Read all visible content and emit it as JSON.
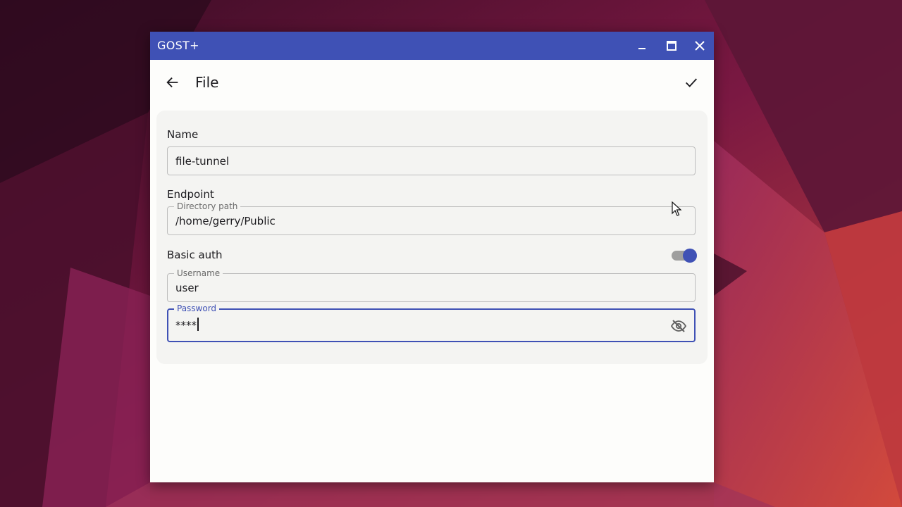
{
  "window": {
    "title": "GOST+",
    "controls": {
      "minimize": "minimize-icon",
      "maximize": "maximize-icon",
      "close": "close-icon"
    }
  },
  "appbar": {
    "back_icon": "arrow-back-icon",
    "title": "File",
    "confirm_icon": "check-icon"
  },
  "form": {
    "name_label": "Name",
    "name_value": "file-tunnel",
    "endpoint_label": "Endpoint",
    "directory_path_legend": "Directory path",
    "directory_path_value": "/home/gerry/Public",
    "basic_auth_label": "Basic auth",
    "basic_auth_enabled": true,
    "username_legend": "Username",
    "username_value": "user",
    "password_legend": "Password",
    "password_value": "****",
    "password_visibility_icon": "eye-off-icon"
  },
  "colors": {
    "accent": "#3f51b5",
    "titlebar": "#3f51b5",
    "surface": "#fdfdfb",
    "card": "#f4f4f2"
  }
}
